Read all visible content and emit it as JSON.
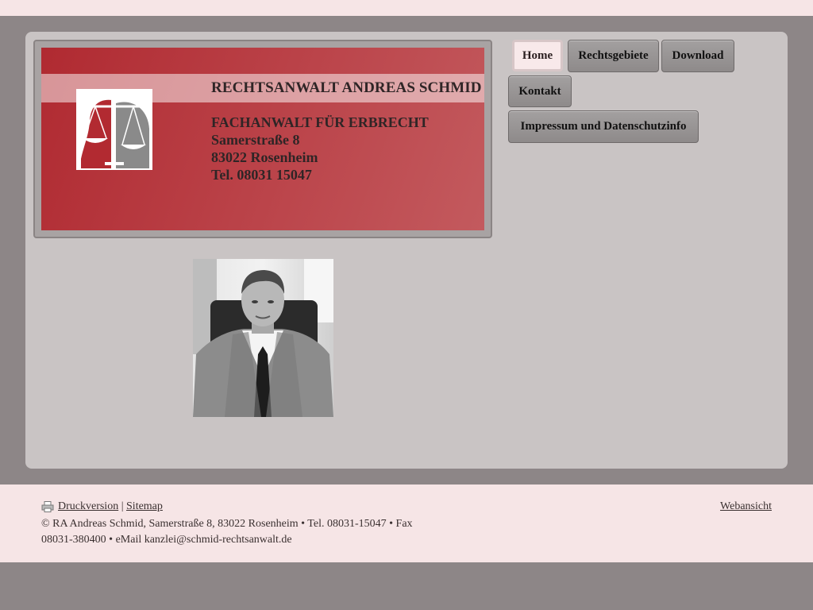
{
  "header": {
    "title": "RECHTSANWALT ANDREAS SCHMID",
    "subtitle": "FACHANWALT FÜR ERBRECHT",
    "street": "Samerstraße 8",
    "city": "83022 Rosenheim",
    "phone": "Tel. 08031 15047"
  },
  "nav": {
    "items": [
      {
        "label": "Home",
        "active": true
      },
      {
        "label": "Rechtsgebiete"
      },
      {
        "label": "Download"
      },
      {
        "label": "Kontakt"
      },
      {
        "label": "Impressum und Datenschutzinfo"
      }
    ]
  },
  "footer": {
    "print_label": "Druckversion",
    "separator": "|",
    "sitemap_label": "Sitemap",
    "copyright": "© RA Andreas Schmid, Samerstraße 8, 83022 Rosenheim • Tel. 08031-15047 • Fax 08031-380400 • eMail kanzlei@schmid-rechtsanwalt.de",
    "webansicht_label": "Webansicht"
  },
  "colors": {
    "page_bg": "#8d8687",
    "panel_bg": "#c9c4c4",
    "banner_red": "#b02a31",
    "footer_bg": "#f6e5e6"
  },
  "icons": {
    "print": "printer-icon",
    "logo": "scales-of-justice-logo"
  }
}
